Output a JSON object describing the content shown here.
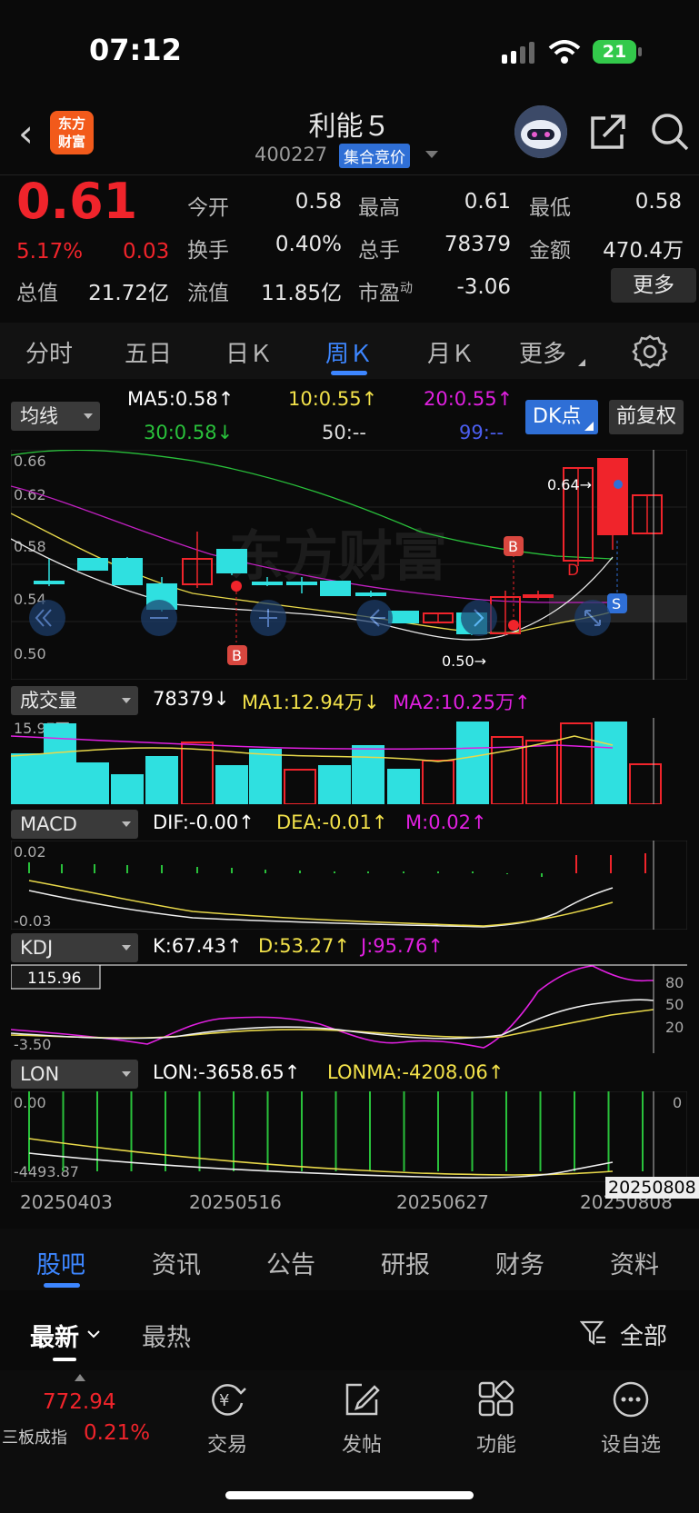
{
  "status": {
    "time": "07:12",
    "battery": "21"
  },
  "header": {
    "logo": "东方\n财富",
    "title": "利能５",
    "code": "400227",
    "badge": "集合竞价"
  },
  "quote": {
    "price": "0.61",
    "change_pct": "5.17%",
    "change": "0.03",
    "open_label": "今开",
    "open": "0.58",
    "high_label": "最高",
    "high": "0.61",
    "low_label": "最低",
    "low": "0.58",
    "turnover_label": "换手",
    "turnover": "0.40%",
    "volume_label": "总手",
    "volume": "78379",
    "amount_label": "金额",
    "amount": "470.4万",
    "mktcap_label": "总值",
    "mktcap": "21.72亿",
    "float_label": "流值",
    "float": "11.85亿",
    "pe_label": "市盈",
    "pe_sup": "动",
    "pe": "-3.06",
    "more": "更多"
  },
  "tabs": [
    "分时",
    "五日",
    "日Ｋ",
    "周Ｋ",
    "月Ｋ",
    "更多"
  ],
  "active_tab": "周Ｋ",
  "ma": {
    "selector": "均线",
    "ma5": "MA5:0.58",
    "ma10": "10:0.55",
    "ma20": "20:0.55",
    "ma30": "30:0.58",
    "ma50": "50:--",
    "ma99": "99:--",
    "dk": "DK点",
    "fq": "前复权"
  },
  "kline": {
    "y_labels": [
      "0.66",
      "0.62",
      "0.58",
      "0.54",
      "0.50"
    ],
    "max_label": "0.64",
    "min_label": "0.50",
    "marker_b": "B",
    "marker_s": "S",
    "marker_d": "D",
    "watermark": "东方财富"
  },
  "volume": {
    "selector": "成交量",
    "value": "78379",
    "ma1": "MA1:12.94万",
    "ma2": "MA2:10.25万",
    "axis": "15.97万"
  },
  "macd": {
    "selector": "MACD",
    "dif": "DIF:-0.00",
    "dea": "DEA:-0.01",
    "m": "M:0.02",
    "top": "0.02",
    "bottom": "-0.03"
  },
  "kdj": {
    "selector": "KDJ",
    "k": "K:67.43",
    "d": "D:53.27",
    "j": "J:95.76",
    "top": "115.96",
    "bottom": "-3.50",
    "r80": "80",
    "r50": "50",
    "r20": "20"
  },
  "lon": {
    "selector": "LON",
    "lon": "LON:-3658.65",
    "lonma": "LONMA:-4208.06",
    "top": "0.00",
    "bottom": "-4493.87",
    "right": "0"
  },
  "dates": [
    "20250403",
    "20250516",
    "20250627",
    "20250808"
  ],
  "cursor_date": "20250808",
  "bottom_tabs": [
    "股吧",
    "资讯",
    "公告",
    "研报",
    "财务",
    "资料"
  ],
  "sub_tabs": {
    "latest": "最新",
    "hot": "最热",
    "filter": "全部"
  },
  "footer": {
    "index_value": "772.94",
    "index_name": "三板成指",
    "index_pct": "0.21%",
    "trade": "交易",
    "post": "发帖",
    "func": "功能",
    "watch": "设自选"
  },
  "colors": {
    "up": "#f0242b",
    "down": "#2fe0e0",
    "ma5": "#ffffff",
    "ma10": "#f2e14a",
    "ma20": "#e020e0",
    "ma30": "#29c13b",
    "accent": "#3d86ff"
  }
}
